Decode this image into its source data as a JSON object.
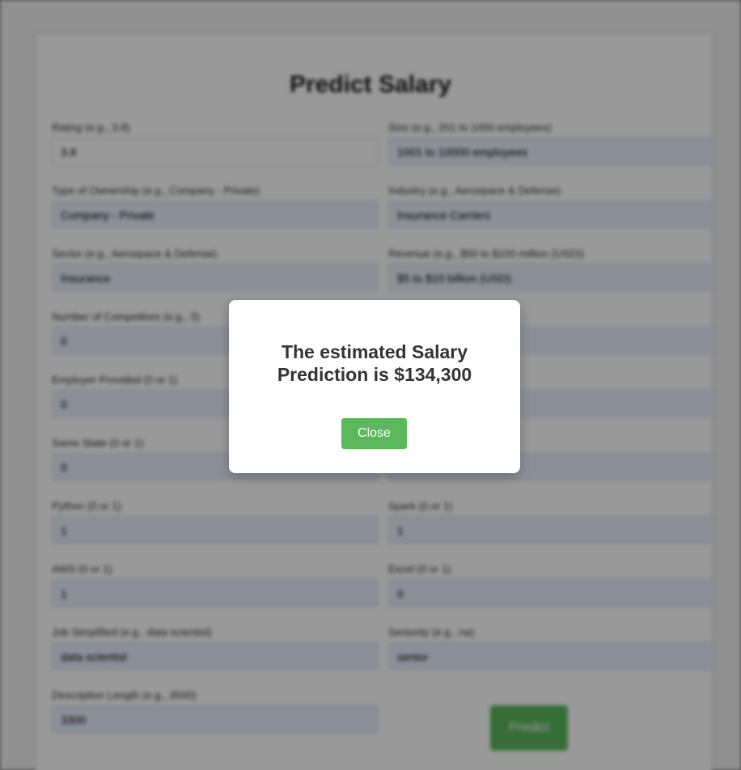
{
  "form": {
    "title": "Predict Salary",
    "fields": [
      {
        "label": "Rating (e.g., 3.8)",
        "value": "3.8"
      },
      {
        "label": "Size (e.g., 201 to 1000 employees)",
        "value": "1001 to 10000 employees"
      },
      {
        "label": "Type of Ownership (e.g., Company - Private)",
        "value": "Company - Private"
      },
      {
        "label": "Industry (e.g., Aerospace & Defense)",
        "value": "Insurance Carriers"
      },
      {
        "label": "Sector (e.g., Aerospace & Defense)",
        "value": "Insurance"
      },
      {
        "label": "Revenue (e.g., $50 to $100 million (USD))",
        "value": "$5 to $10 billion (USD)"
      },
      {
        "label": "Number of Competitors (e.g., 3)",
        "value": "0"
      },
      {
        "label": "",
        "value": ""
      },
      {
        "label": "Employer Provided (0 or 1)",
        "value": "0"
      },
      {
        "label": "",
        "value": ""
      },
      {
        "label": "Same State (0 or 1)",
        "value": "0"
      },
      {
        "label": "",
        "value": ""
      },
      {
        "label": "Python (0 or 1)",
        "value": "1"
      },
      {
        "label": "Spark (0 or 1)",
        "value": "1"
      },
      {
        "label": "AWS (0 or 1)",
        "value": "1"
      },
      {
        "label": "Excel (0 or 1)",
        "value": "0"
      },
      {
        "label": "Job Simplified (e.g., data scientist)",
        "value": "data scientist"
      },
      {
        "label": "Seniority (e.g., na)",
        "value": "senior"
      },
      {
        "label": "Description Length (e.g., 3500)",
        "value": "3300"
      }
    ],
    "predict_label": "Predict"
  },
  "modal": {
    "message": "The estimated Salary Prediction is $134,300",
    "close_label": "Close"
  },
  "colors": {
    "button_green": "#5cb85c",
    "input_fill": "#e8f0fe",
    "text_dark": "#333333"
  }
}
